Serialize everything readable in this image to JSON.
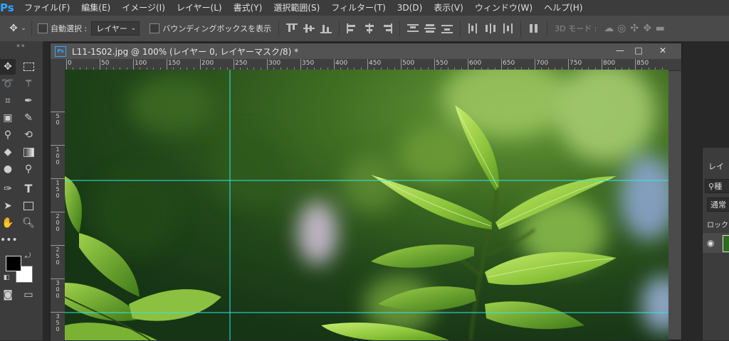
{
  "app": {
    "logo": "Ps"
  },
  "menu": [
    "ファイル(F)",
    "編集(E)",
    "イメージ(I)",
    "レイヤー(L)",
    "書式(Y)",
    "選択範囲(S)",
    "フィルター(T)",
    "3D(D)",
    "表示(V)",
    "ウィンドウ(W)",
    "ヘルプ(H)"
  ],
  "options": {
    "move_icon": "move-icon",
    "auto_select_label": "自動選択 :",
    "auto_select_value": "レイヤー",
    "bbox_label": "バウンディングボックスを表示",
    "mode3d_label": "3D モード :"
  },
  "document": {
    "badge": "Ps",
    "title": "L11-1S02.jpg @ 100% (レイヤー 0, レイヤーマスク/8) *",
    "minimize": "—",
    "maximize": "□",
    "close": "✕",
    "hruler_ticks": [
      "0",
      "50",
      "100",
      "150",
      "200",
      "250",
      "300",
      "350",
      "400",
      "450",
      "500",
      "550",
      "600",
      "650",
      "700",
      "750",
      "800",
      "850"
    ],
    "vruler_ticks": [
      "5 0",
      "1 0 0",
      "1 5 0",
      "2 0 0",
      "2 5 0",
      "3 0 0",
      "3 5 0"
    ]
  },
  "layers_panel": {
    "tab": "レイ",
    "search_prefix": "種",
    "blend_mode": "通常",
    "lock_label": "ロック :"
  },
  "colors": {
    "accent": "#31a8ff",
    "guide": "#33e6e6",
    "foreground": "#000000",
    "background": "#ffffff"
  }
}
